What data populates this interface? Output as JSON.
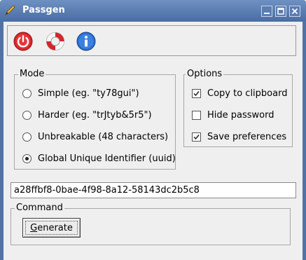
{
  "window": {
    "title": "Passgen",
    "colors": {
      "titlebar": "#4f73a7",
      "client": "#efefef"
    }
  },
  "titlebar_buttons": [
    {
      "icon": "minimize-icon"
    },
    {
      "icon": "maximize-icon"
    },
    {
      "icon": "close-icon"
    }
  ],
  "toolbar": {
    "items": [
      {
        "icon": "power-icon"
      },
      {
        "icon": "lifebuoy-icon"
      },
      {
        "icon": "info-icon"
      }
    ]
  },
  "mode": {
    "label": "Mode",
    "options": [
      {
        "label": "Simple (eg. \"ty78gui\")",
        "selected": false
      },
      {
        "label": "Harder (eg. \"trJtyb&5r5\")",
        "selected": false
      },
      {
        "label": "Unbreakable (48 characters)",
        "selected": false
      },
      {
        "label": "Global Unique Identifier (uuid)",
        "selected": true
      }
    ]
  },
  "options": {
    "label": "Options",
    "items": [
      {
        "label": "Copy to clipboard",
        "checked": true
      },
      {
        "label": "Hide password",
        "checked": false
      },
      {
        "label": "Save preferences",
        "checked": true
      }
    ]
  },
  "output": {
    "value": "a28ffbf8-0bae-4f98-8a12-58143dc2b5c8"
  },
  "command": {
    "label": "Command",
    "generate_mnemonic": "G",
    "generate_rest": "enerate"
  }
}
